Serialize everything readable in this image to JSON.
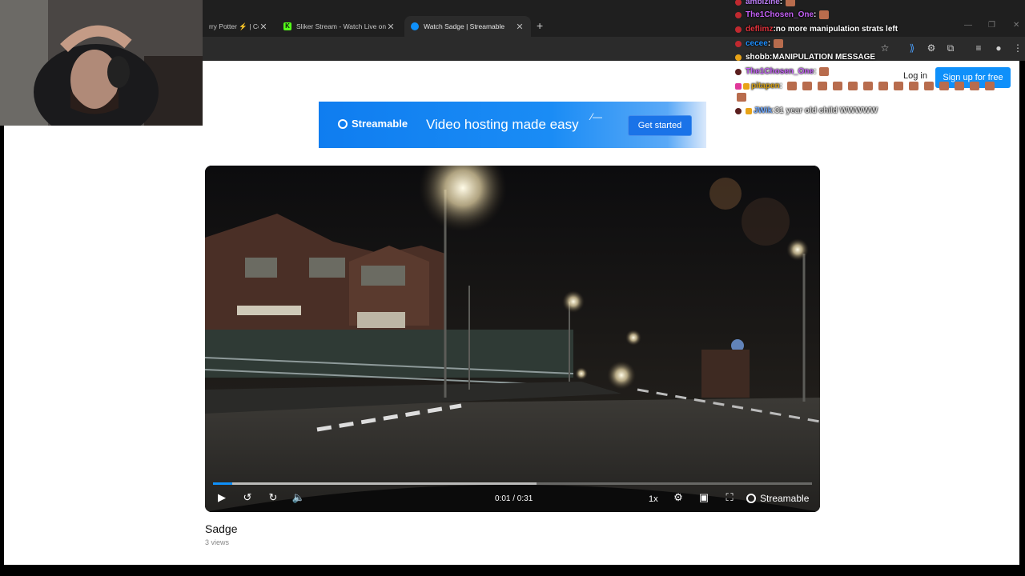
{
  "browser": {
    "tabs": [
      {
        "label": "rry Potter ⚡ | Com"
      },
      {
        "label": "Sliker Stream - Watch Live on K"
      },
      {
        "label": "Watch Sadge | Streamable"
      }
    ],
    "new_tab": "+"
  },
  "header": {
    "login": "Log in",
    "signup": "Sign up for free"
  },
  "banner": {
    "brand": "Streamable",
    "tagline": "Video hosting made easy",
    "cta": "Get started"
  },
  "player": {
    "time": "0:01 / 0:31",
    "speed": "1x",
    "brand": "Streamable",
    "progress_fraction": 0.032,
    "buffered_fraction": 0.54
  },
  "video_info": {
    "title": "Sadge",
    "views": "3 views"
  },
  "chat": [
    {
      "user": "ambizine",
      "sep": " :",
      "text": "",
      "color": "#b97cf3"
    },
    {
      "user": "The1Chosen_One",
      "sep": " :",
      "text": "",
      "color": "#c35ff5"
    },
    {
      "user": "deflimz",
      "sep": " :",
      "text": " no more manipulation strats left",
      "color": "#e0323c"
    },
    {
      "user": "cecee",
      "sep": " :",
      "text": "",
      "color": "#1e90ff"
    },
    {
      "user": "shobb",
      "sep": " :",
      "text": " MANIPULATION MESSAGE",
      "color": "#ffffff"
    },
    {
      "user": "The1Chosen_One",
      "sep": " :",
      "text": "",
      "color": "#c35ff5"
    },
    {
      "user": "pitapen",
      "sep": " :",
      "text": "",
      "color": "#d4a017"
    },
    {
      "user": "JWik",
      "sep": " :",
      "text": " 31 year old child WWWWW",
      "color": "#6fa8ff"
    }
  ]
}
